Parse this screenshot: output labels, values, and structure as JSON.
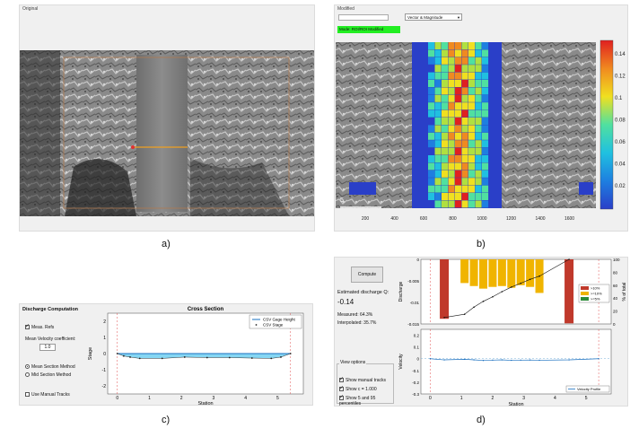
{
  "panel_a": {
    "title": "Original",
    "caption": "a)"
  },
  "panel_b": {
    "title": "Modified",
    "dropdown_value": "Vector & Magnitude",
    "status_text": "Mode: ROI/ROI Modified",
    "scale_label": "5",
    "x_ticks": [
      "200",
      "400",
      "600",
      "800",
      "1000",
      "1200",
      "1400",
      "1600"
    ],
    "colorbar_ticks": [
      "0.14",
      "0.12",
      "0.1",
      "0.08",
      "0.06",
      "0.04",
      "0.02"
    ],
    "caption": "b)"
  },
  "panel_c": {
    "title": "Discharge Computation",
    "meas_label": "Meas. Refs",
    "coef_label": "Mean Velocity coefficient:",
    "coef_value": "1.0",
    "method_mean": "Mean Section Method",
    "method_mid": "Mid Section Method",
    "manual_label": "Use Manual Tracks",
    "caption": "c)"
  },
  "panel_d": {
    "compute_label": "Compute",
    "est_label": "Estimated discharge Q:",
    "est_value": "-0.14",
    "measured": "Measured: 64.3%",
    "interpolated": "Interpolated: 35.7%",
    "view_options": "View options",
    "opt_manual": "Show manual tracks",
    "opt_c": "Show c = 1.000",
    "opt_percentiles": "Show 5 and 95 percentiles",
    "caption": "d)"
  },
  "chart_data": [
    {
      "type": "line",
      "title": "Cross Section",
      "xlabel": "Station",
      "ylabel": "Stage",
      "xlim": [
        -0.3,
        5.8
      ],
      "ylim": [
        -2.5,
        2.5
      ],
      "xticks": [
        0,
        1,
        2,
        3,
        4,
        5
      ],
      "yticks": [
        2,
        1,
        0,
        -1,
        -2
      ],
      "legend": [
        "CSV Gage Height",
        "CSV Stage"
      ],
      "legend_position": "top-right",
      "series": [
        {
          "name": "CSV Gage Height",
          "x": [
            0,
            5.4
          ],
          "y": [
            0,
            0
          ]
        },
        {
          "name": "CSV Stage",
          "x": [
            0,
            0.2,
            0.4,
            0.7,
            1.4,
            2.1,
            2.8,
            3.5,
            4.2,
            4.8,
            5.1,
            5.4
          ],
          "y": [
            0,
            -0.15,
            -0.22,
            -0.3,
            -0.3,
            -0.22,
            -0.25,
            -0.25,
            -0.28,
            -0.3,
            -0.22,
            0
          ]
        }
      ]
    },
    {
      "type": "bar",
      "ylabel": "Discharge",
      "ylabel_right": "% of total",
      "ylim": [
        -0.015,
        0
      ],
      "ylim_right": [
        0,
        100
      ],
      "yticks": [
        "0",
        "-0.005",
        "-0.01",
        "-0.015"
      ],
      "yticks_right": [
        "100",
        "80",
        "60",
        "40",
        "20",
        "0"
      ],
      "legend": [
        ">10%",
        ">=10%",
        ">=5%"
      ],
      "legend_colors": [
        "#c0392b",
        "#f0b400",
        "#2e8b3a"
      ],
      "legend_position": "top-right",
      "bars": [
        {
          "x": 0.45,
          "value": -0.0138,
          "color": "#c0392b"
        },
        {
          "x": 1.1,
          "value": -0.0055,
          "color": "#f0b400"
        },
        {
          "x": 1.4,
          "value": -0.0062,
          "color": "#f0b400"
        },
        {
          "x": 1.7,
          "value": -0.0068,
          "color": "#f0b400"
        },
        {
          "x": 2.0,
          "value": -0.0064,
          "color": "#f0b400"
        },
        {
          "x": 2.3,
          "value": -0.0062,
          "color": "#f0b400"
        },
        {
          "x": 2.6,
          "value": -0.0066,
          "color": "#f0b400"
        },
        {
          "x": 2.9,
          "value": -0.006,
          "color": "#f0b400"
        },
        {
          "x": 3.2,
          "value": -0.0064,
          "color": "#f0b400"
        },
        {
          "x": 3.5,
          "value": -0.0078,
          "color": "#f0b400"
        },
        {
          "x": 4.45,
          "value": -0.0272,
          "color": "#c0392b"
        }
      ],
      "cumulative_x": [
        0.45,
        1.1,
        1.4,
        1.7,
        2.0,
        2.3,
        2.6,
        2.9,
        3.2,
        3.5,
        4.45
      ],
      "cumulative_y": [
        10,
        15,
        26,
        35,
        42,
        50,
        57,
        63,
        69,
        74,
        100
      ]
    },
    {
      "type": "line",
      "xlabel": "Station",
      "ylabel": "Velocity",
      "xlim": [
        -0.3,
        5.8
      ],
      "ylim": [
        -0.3,
        0.25
      ],
      "xticks": [
        0,
        1,
        2,
        3,
        4,
        5
      ],
      "yticks": [
        "0.2",
        "0.1",
        "0",
        "-0.1",
        "-0.2",
        "-0.3"
      ],
      "legend": [
        "Velocity Profile"
      ],
      "legend_position": "bottom-right",
      "series": [
        {
          "name": "Velocity Profile",
          "x": [
            0,
            0.45,
            1.1,
            1.4,
            1.7,
            2.0,
            2.3,
            2.6,
            2.9,
            3.2,
            3.5,
            4.45,
            5.4
          ],
          "y": [
            0,
            -0.01,
            -0.005,
            -0.01,
            -0.015,
            -0.012,
            -0.01,
            -0.014,
            -0.012,
            -0.011,
            -0.013,
            -0.01,
            0
          ]
        }
      ]
    }
  ]
}
